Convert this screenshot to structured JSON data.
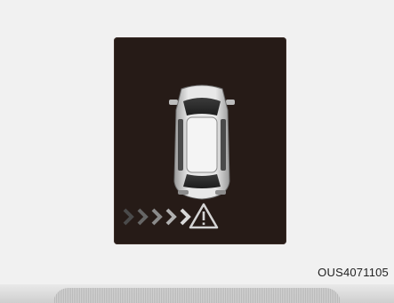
{
  "figure": {
    "code": "OUS4071105"
  },
  "display": {
    "icons": [
      "top-view-car-icon",
      "approaching-chevrons-icon",
      "warning-triangle-icon"
    ],
    "colors": {
      "panel_bg": "#261b17",
      "car_body": "#d9d9d9",
      "warning": "#cfcfcf"
    }
  }
}
